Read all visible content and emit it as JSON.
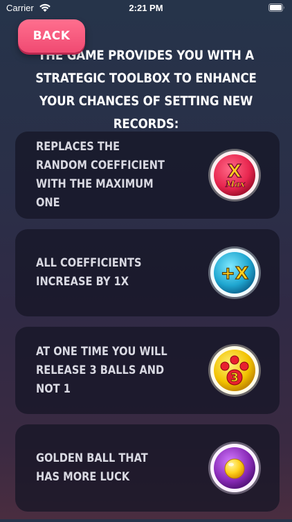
{
  "status_bar": {
    "carrier": "Carrier",
    "time": "2:21 PM"
  },
  "header": {
    "back_label": "BACK",
    "intro": "THE GAME PROVIDES YOU WITH A STRATEGIC TOOLBOX TO ENHANCE YOUR CHANCES OF SETTING NEW RECORDS:"
  },
  "boosters": [
    {
      "description": "REPLACES THE RANDOM COEFFICIENT WITH THE MAXIMUM ONE",
      "icon": "x-max-booster-icon",
      "badge_main": "X",
      "badge_sub": "Max",
      "color": "#e8264f"
    },
    {
      "description": "ALL COEFFICIENTS INCREASE BY 1X",
      "icon": "plus-x-booster-icon",
      "badge_main": "+X",
      "color": "#2ab8d8"
    },
    {
      "description": "AT ONE TIME YOU WILL RELEASE 3 BALLS AND NOT 1",
      "icon": "three-balls-booster-icon",
      "badge_main": "3",
      "color": "#f2c200"
    },
    {
      "description": "GOLDEN BALL THAT HAS MORE LUCK",
      "icon": "golden-ball-booster-icon",
      "color": "#8a2bb8"
    }
  ]
}
